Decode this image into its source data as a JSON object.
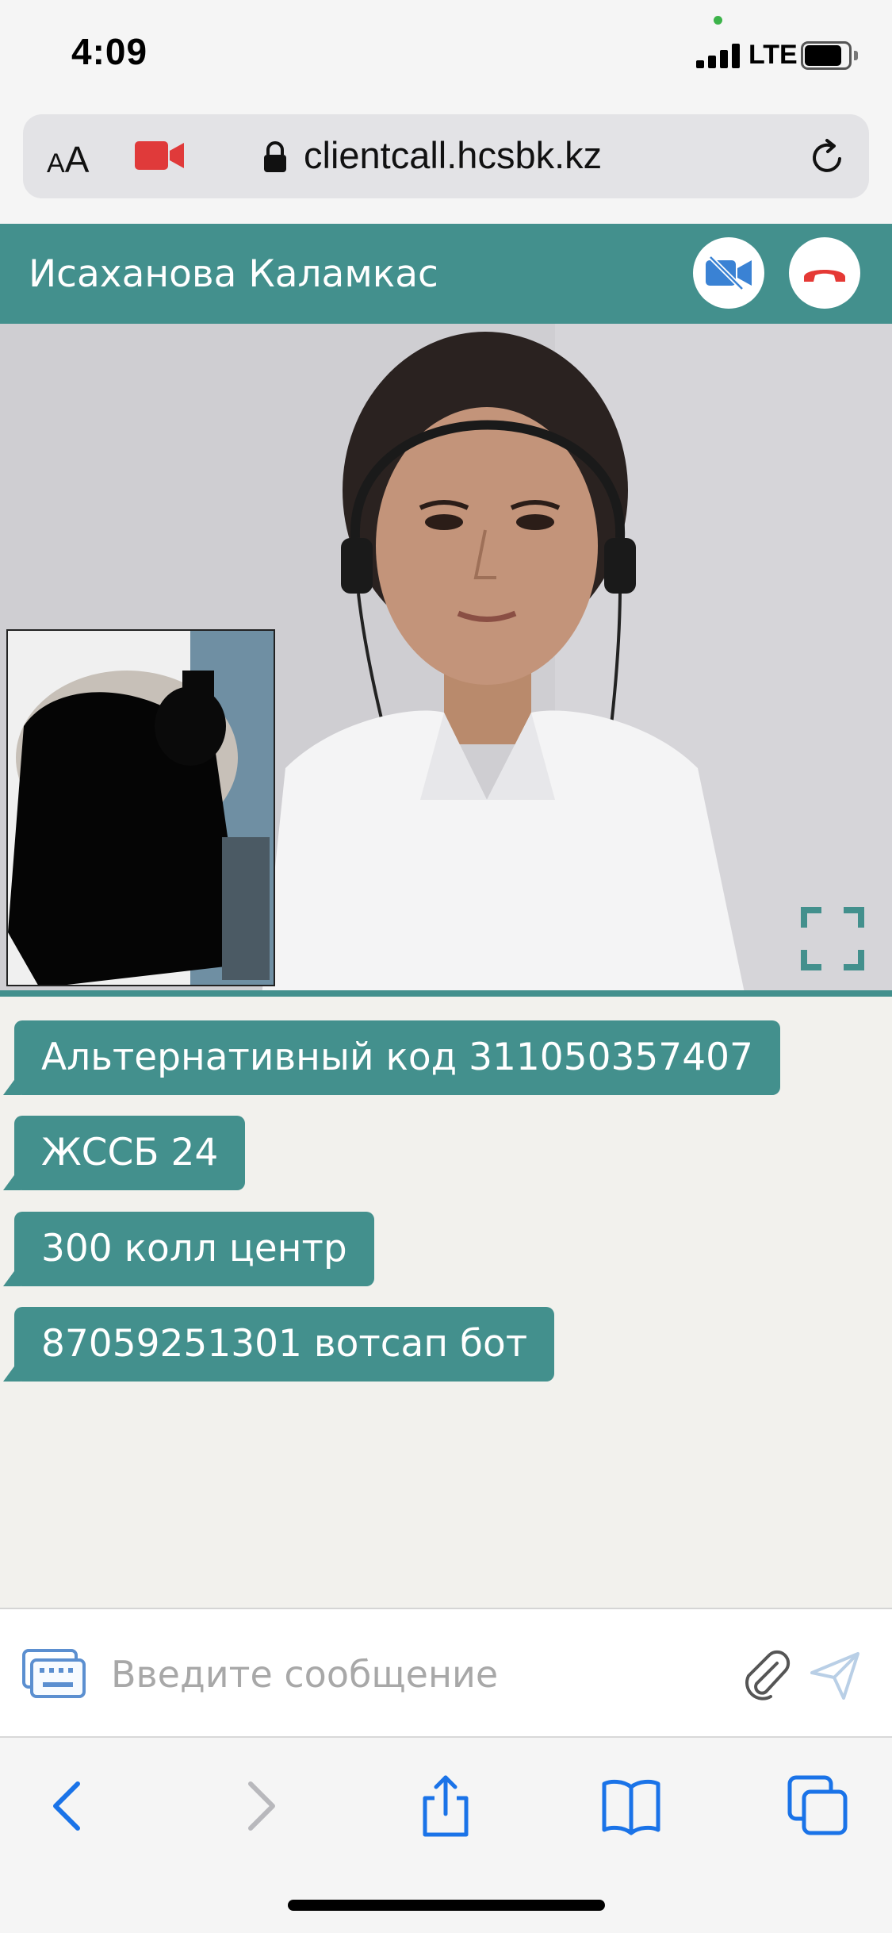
{
  "status_bar": {
    "time": "4:09",
    "network": "LTE",
    "battery_level": 0.85
  },
  "browser": {
    "text_size_label_small": "A",
    "text_size_label_large": "A",
    "url": "clientcall.hcsbk.kz",
    "icons": [
      "camera-recording-icon",
      "lock-icon",
      "reload-icon"
    ]
  },
  "call": {
    "caller_name": "Исаханова Каламкас",
    "icons": [
      "video-off-icon",
      "hangup-icon",
      "fullscreen-icon"
    ]
  },
  "chat": {
    "messages": [
      "Альтернативный код 311050357407",
      "ЖССБ 24",
      "300 колл центр",
      "87059251301 вотсап бот"
    ]
  },
  "composer": {
    "placeholder": "Введите сообщение",
    "icons": [
      "keyboard-icon",
      "attach-icon",
      "send-icon"
    ]
  },
  "toolbar": {
    "icons": [
      "back-icon",
      "forward-icon",
      "share-icon",
      "bookmarks-icon",
      "tabs-icon"
    ]
  },
  "colors": {
    "accent": "#43908d",
    "hangup": "#e53935",
    "video_icon": "#3a82d4",
    "browser_blue": "#1a73e8"
  }
}
